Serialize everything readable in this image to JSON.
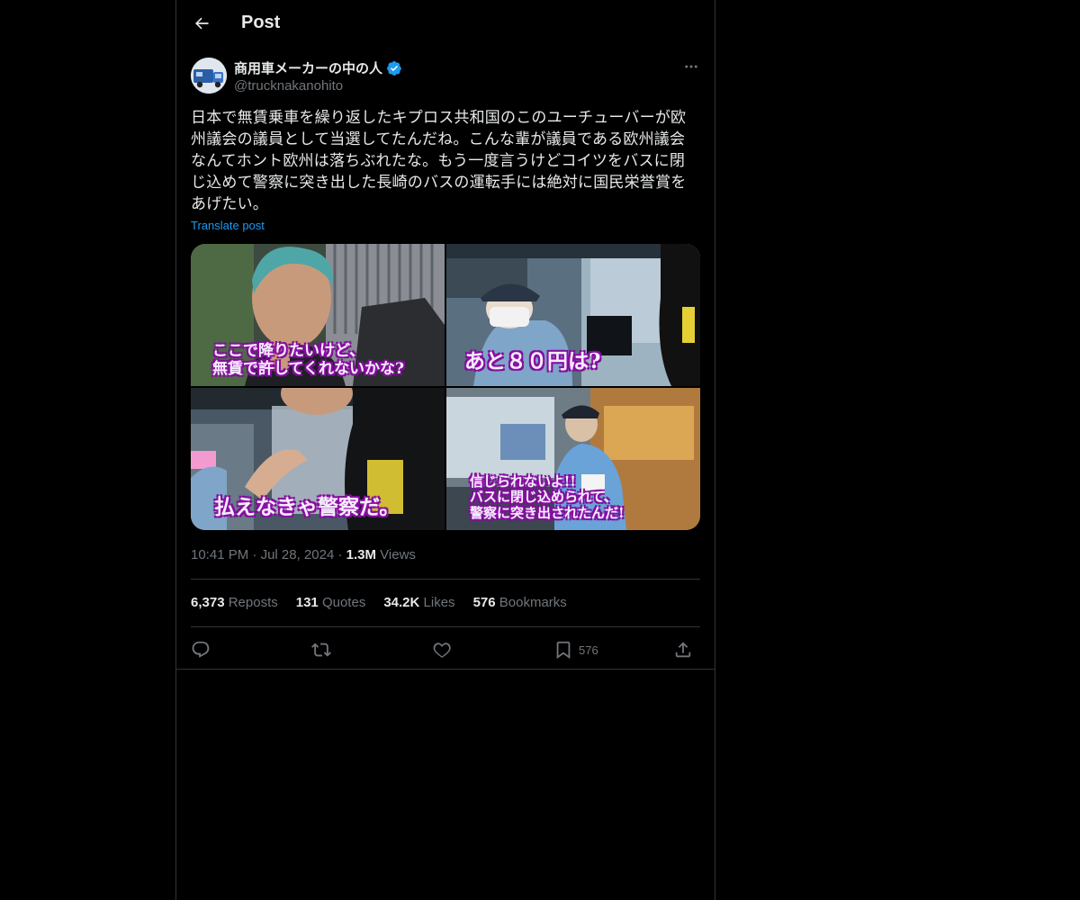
{
  "header": {
    "title": "Post"
  },
  "author": {
    "name": "商用車メーカーの中の人",
    "handle": "@trucknakanohito",
    "verified_color": "#1d9bf0"
  },
  "post": {
    "text": "日本で無賃乗車を繰り返したキプロス共和国のこのユーチューバーが欧州議会の議員として当選してたんだね。こんな輩が議員である欧州議会なんてホント欧州は落ちぶれたな。もう一度言うけどコイツをバスに閉じ込めて警察に突き出した長崎のバスの運転手には絶対に国民栄誉賞をあげたい。",
    "translate_label": "Translate post"
  },
  "media": {
    "captions": [
      "ここで降りたいけど、\n無賃で許してくれないかな?",
      "あと８０円は?",
      "払えなきゃ警察だ。",
      "信じられないよ!!\nバスに閉じ込められて、\n警察に突き出されたんだ!"
    ]
  },
  "meta": {
    "time": "10:41 PM",
    "date": "Jul 28, 2024",
    "views_count": "1.3M",
    "views_label": "Views",
    "sep": "·"
  },
  "stats": [
    {
      "count": "6,373",
      "label": "Reposts"
    },
    {
      "count": "131",
      "label": "Quotes"
    },
    {
      "count": "34.2K",
      "label": "Likes"
    },
    {
      "count": "576",
      "label": "Bookmarks"
    }
  ],
  "actions": {
    "reply_icon": "reply-icon",
    "repost_icon": "repost-icon",
    "like_icon": "heart-icon",
    "bookmark_icon": "bookmark-icon",
    "bookmark_count": "576",
    "share_icon": "share-icon"
  }
}
